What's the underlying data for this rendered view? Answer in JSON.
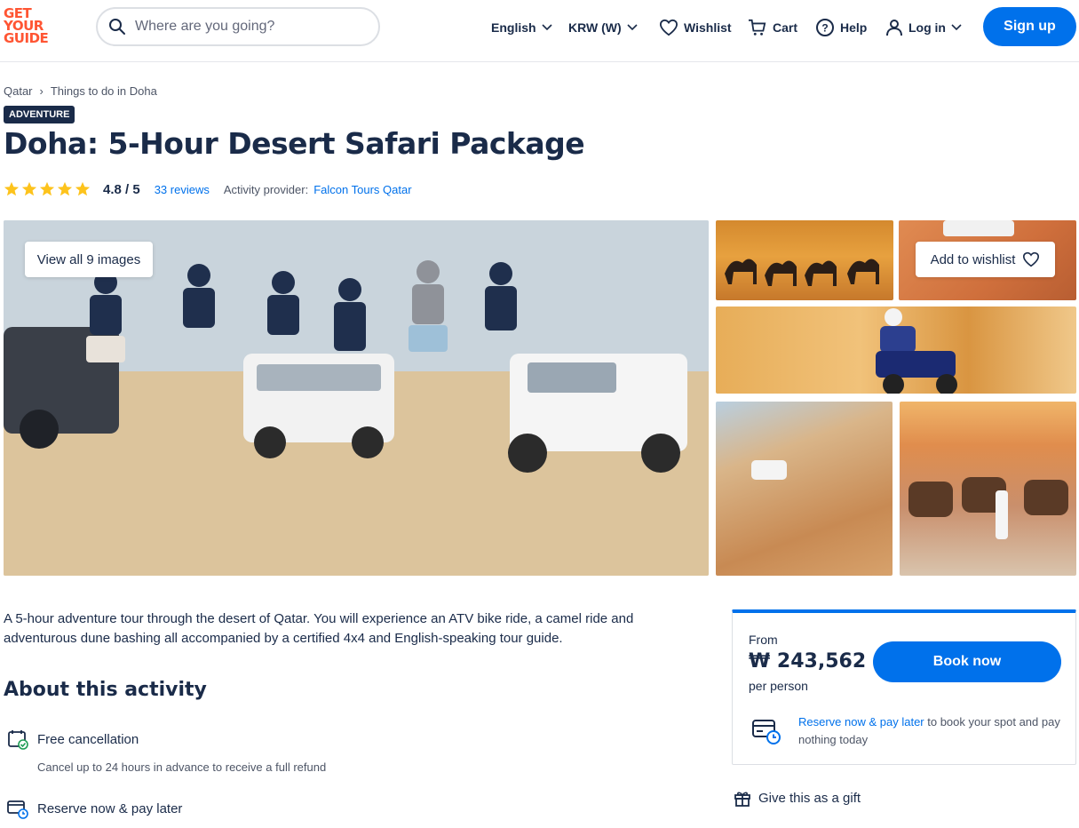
{
  "header": {
    "logo_lines": [
      "GET",
      "YOUR",
      "GUIDE"
    ],
    "search_placeholder": "Where are you going?",
    "language": "English",
    "currency": "KRW (W)",
    "wishlist": "Wishlist",
    "cart": "Cart",
    "help": "Help",
    "login": "Log in",
    "signup": "Sign up"
  },
  "breadcrumb": {
    "items": [
      "Qatar",
      "Things to do in Doha"
    ],
    "separator": "›"
  },
  "activity": {
    "category_badge": "ADVENTURE",
    "title": "Doha: 5-Hour Desert Safari Package",
    "rating_stars": 5,
    "rating_text": "4.8 / 5",
    "reviews_link": "33 reviews",
    "provider_label": "Activity provider:",
    "provider_name": "Falcon Tours Qatar",
    "star_color": "#fdc31c"
  },
  "gallery": {
    "view_all_button": "View all 9 images",
    "add_wishlist_button": "Add to wishlist"
  },
  "summary": "A 5-hour adventure tour through the desert of Qatar. You will experience an ATV bike ride, a camel ride and adventurous dune bashing all accompanied by a certified 4x4 and English-speaking tour guide.",
  "about": {
    "heading": "About this activity",
    "features": [
      {
        "title": "Free cancellation",
        "subtitle": "Cancel up to 24 hours in advance to receive a full refund",
        "icon": "calendar-check-icon"
      },
      {
        "title": "Reserve now & pay later",
        "icon": "card-clock-icon"
      }
    ]
  },
  "booking": {
    "from_label": "From",
    "price": "₩ 243,562",
    "per_person": "per person",
    "book_button": "Book now",
    "rnpl_link": "Reserve now & pay later",
    "rnpl_text": " to book your spot and pay nothing today",
    "gift": "Give this as a gift"
  },
  "colors": {
    "brand_orange": "#ff5533",
    "primary_blue": "#0071eb",
    "navy": "#1a2b49"
  }
}
